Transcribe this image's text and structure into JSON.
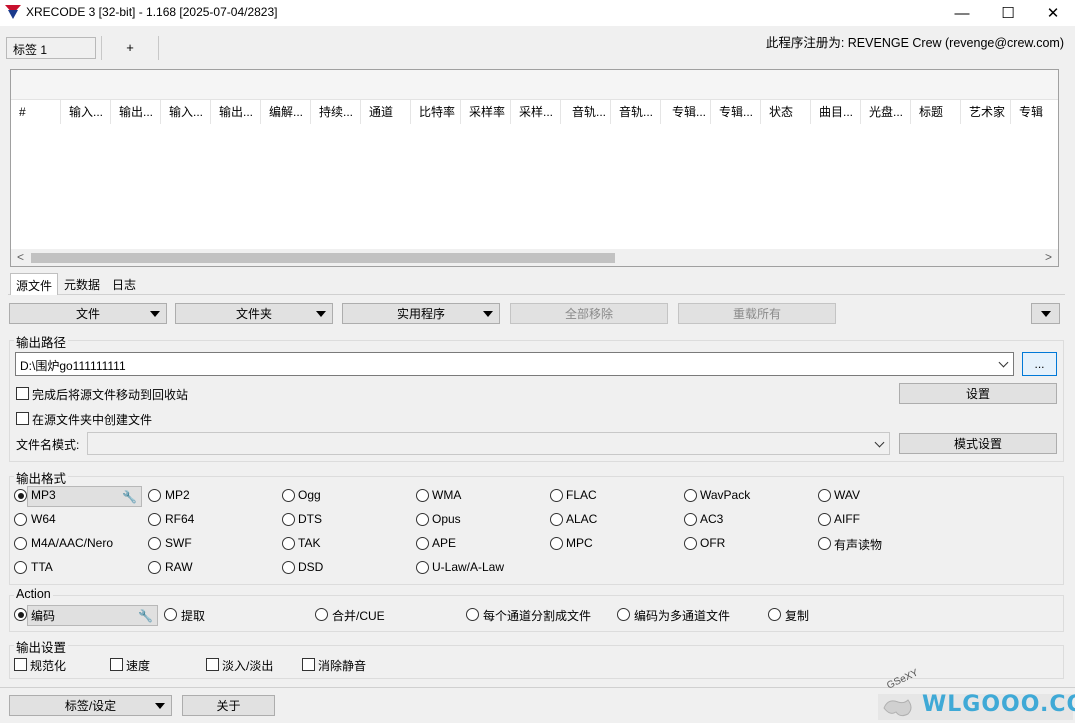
{
  "window": {
    "title": "XRECODE 3 [32-bit] - 1.168 [2025-07-04/2823]",
    "minimize": "—",
    "maximize": "☐",
    "close": "✕"
  },
  "tabs": {
    "tab1_label": "标签 1",
    "add_label": "+"
  },
  "registration": "此程序注册为: REVENGE Crew (revenge@crew.com)",
  "list": {
    "columns": [
      "#",
      "输入...",
      "输出...",
      "输入...",
      "输出...",
      "编解...",
      "持续...",
      "通道",
      "比特率",
      "采样率",
      "采样...",
      "音轨...",
      "音轨...",
      "专辑...",
      "专辑...",
      "状态",
      "曲目...",
      "光盘...",
      "标题",
      "艺术家",
      "专辑"
    ],
    "scroll_left": "<",
    "scroll_right": ">"
  },
  "lower_tabs": [
    "源文件",
    "元数据",
    "日志"
  ],
  "toolbar": {
    "file": "文件",
    "folder": "文件夹",
    "utilities": "实用程序",
    "remove_all": "全部移除",
    "reset_all": "重载所有"
  },
  "output_path": {
    "title": "输出路径",
    "value": "D:\\围炉go111111111",
    "browse": "...",
    "move_to_recycle": "完成后将源文件移动到回收站",
    "create_in_source": "在源文件夹中创建文件",
    "settings": "设置",
    "filename_pattern_label": "文件名模式:",
    "pattern_settings": "模式设置"
  },
  "output_format": {
    "title": "输出格式",
    "selected": "MP3",
    "options": [
      [
        "MP3",
        "MP2",
        "Ogg",
        "WMA",
        "FLAC",
        "WavPack",
        "WAV"
      ],
      [
        "W64",
        "RF64",
        "DTS",
        "Opus",
        "ALAC",
        "AC3",
        "AIFF"
      ],
      [
        "M4A/AAC/Nero",
        "SWF",
        "TAK",
        "APE",
        "MPC",
        "OFR",
        "有声读物"
      ],
      [
        "TTA",
        "RAW",
        "DSD",
        "U-Law/A-Law"
      ]
    ]
  },
  "action": {
    "title": "Action",
    "options": [
      "编码",
      "提取",
      "合并/CUE",
      "每个通道分割成文件",
      "编码为多通道文件",
      "复制"
    ],
    "selected": "编码"
  },
  "output_settings": {
    "title": "输出设置",
    "options": [
      "规范化",
      "速度",
      "淡入/淡出",
      "消除静音"
    ]
  },
  "bottom": {
    "tags_settings": "标签/设定",
    "about": "关于"
  },
  "watermark": {
    "text": "WLGOOO.COM",
    "small": "GSeXY"
  }
}
